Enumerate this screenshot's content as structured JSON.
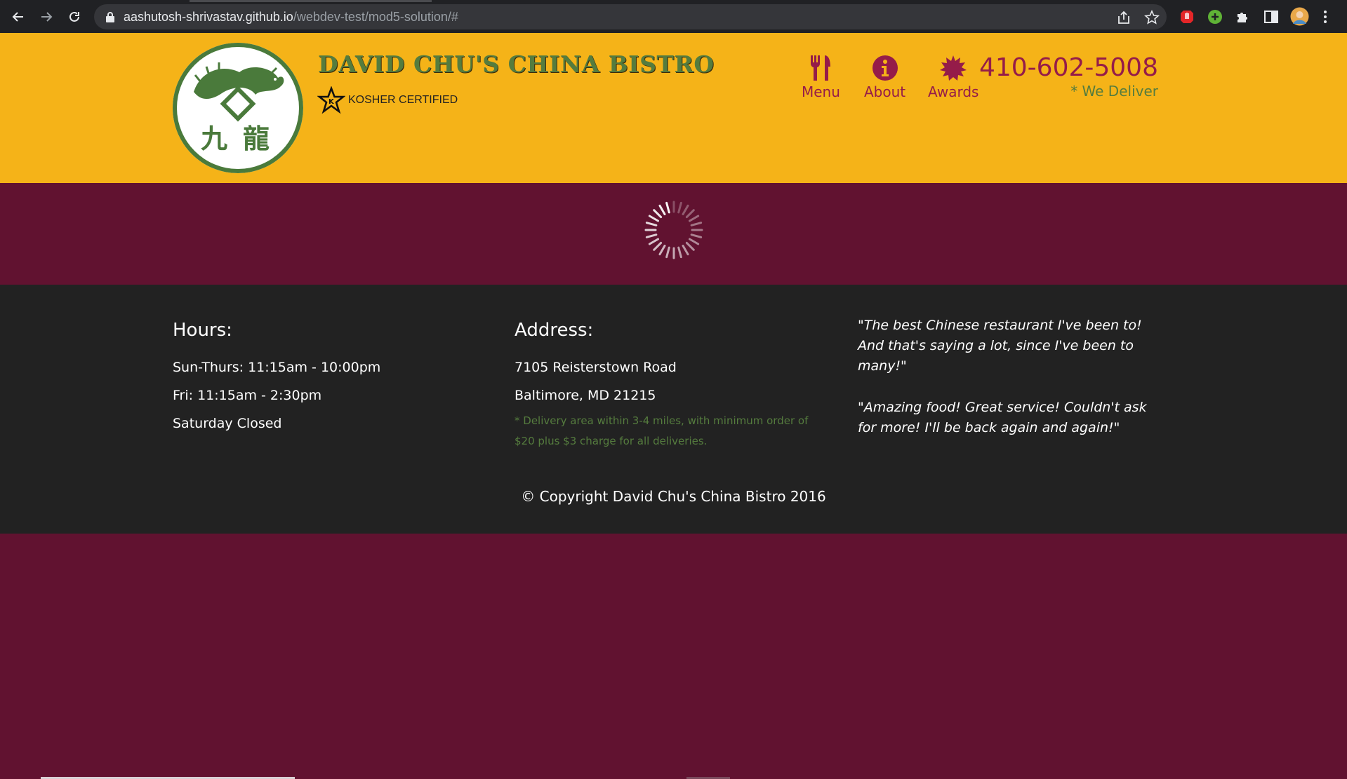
{
  "browser": {
    "url_host": "aashutosh-shrivastav.github.io",
    "url_path": "/webdev-test/mod5-solution/#"
  },
  "header": {
    "title": "DAVID CHU'S CHINA BISTRO",
    "kosher_label": "KOSHER CERTIFIED",
    "nav": [
      {
        "label": "Menu",
        "icon": "utensils-icon"
      },
      {
        "label": "About",
        "icon": "info-icon"
      },
      {
        "label": "Awards",
        "icon": "award-icon"
      }
    ],
    "phone": "410-602-5008",
    "deliver": "* We Deliver"
  },
  "footer": {
    "hours": {
      "title": "Hours:",
      "lines": [
        "Sun-Thurs: 11:15am - 10:00pm",
        "Fri: 11:15am - 2:30pm",
        "Saturday Closed"
      ]
    },
    "address": {
      "title": "Address:",
      "lines": [
        "7105 Reisterstown Road",
        "Baltimore, MD 21215"
      ],
      "note": "* Delivery area within 3-4 miles, with minimum order of $20 plus $3 charge for all deliveries."
    },
    "testimonials": [
      "\"The best Chinese restaurant I've been to! And that's saying a lot, since I've been to many!\"",
      "\"Amazing food! Great service! Couldn't ask for more! I'll be back again and again!\""
    ],
    "copyright": "© Copyright David Chu's China Bistro 2016"
  },
  "colors": {
    "header_bg": "#f5b318",
    "main_bg": "#611230",
    "footer_bg": "#222222",
    "accent": "#951c49",
    "green": "#557c3e"
  }
}
